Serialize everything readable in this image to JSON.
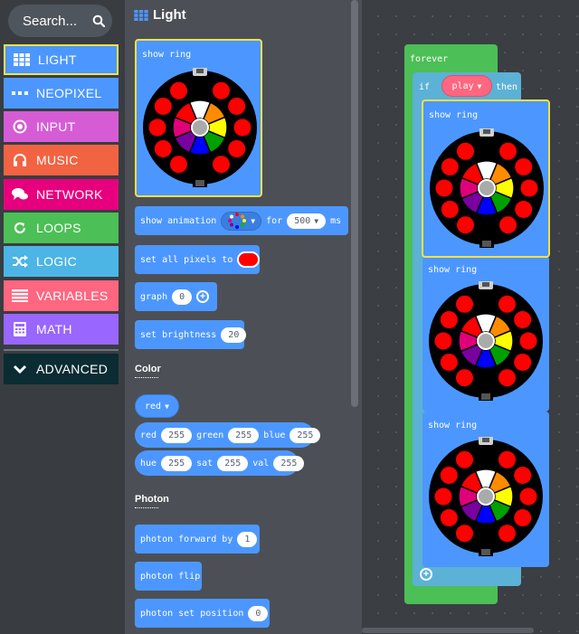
{
  "sidebar": {
    "search": {
      "label": "Search...",
      "icon": "search-icon"
    },
    "categories": [
      {
        "label": "LIGHT",
        "color": "#4c97ff",
        "icon": "grid-icon",
        "selected": true
      },
      {
        "label": "NEOPIXEL",
        "color": "#4c97ff",
        "icon": "dots-icon"
      },
      {
        "label": "INPUT",
        "color": "#d65cd6",
        "icon": "radio-circle-icon"
      },
      {
        "label": "MUSIC",
        "color": "#f26342",
        "icon": "headphones-icon"
      },
      {
        "label": "NETWORK",
        "color": "#e6007e",
        "icon": "chat-icon"
      },
      {
        "label": "LOOPS",
        "color": "#4cbf56",
        "icon": "refresh-icon"
      },
      {
        "label": "LOGIC",
        "color": "#4cb5e5",
        "icon": "shuffle-icon"
      },
      {
        "label": "VARIABLES",
        "color": "#ff6680",
        "icon": "list-lines-icon"
      },
      {
        "label": "MATH",
        "color": "#9966ff",
        "icon": "calculator-icon"
      },
      {
        "label": "ADVANCED",
        "color": "#0b2c33",
        "icon": "chevron-down-icon"
      }
    ]
  },
  "flyout": {
    "title": "Light",
    "blocks": {
      "show_ring": "show ring",
      "show_animation": "show animation",
      "show_animation_for": "for",
      "show_animation_duration": "500",
      "show_animation_unit": "ms",
      "set_all_pixels_to": "set all pixels to",
      "graph": "graph",
      "graph_value": "0",
      "set_brightness": "set brightness",
      "set_brightness_value": "20"
    },
    "color_section": {
      "label": "Color",
      "red_dropdown": "red",
      "rgb": {
        "red_label": "red",
        "red": "255",
        "green_label": "green",
        "green": "255",
        "blue_label": "blue",
        "blue": "255"
      },
      "hsv": {
        "hue_label": "hue",
        "hue": "255",
        "sat_label": "sat",
        "sat": "255",
        "val_label": "val",
        "val": "255"
      }
    },
    "photon_section": {
      "label": "Photon",
      "forward_label": "photon forward by",
      "forward_value": "1",
      "flip_label": "photon flip",
      "set_position_label": "photon set position",
      "set_position_value": "0"
    }
  },
  "workspace": {
    "forever": "forever",
    "if": "if",
    "condition": "play",
    "then": "then",
    "ring_labels": [
      "show ring",
      "show ring",
      "show ring"
    ]
  },
  "colors": {
    "light_block": "#4c97ff",
    "loops_block": "#4cbf56",
    "logic_block": "#5cb1d6",
    "variable_pill": "#ff6680",
    "selection_outline": "#f6e04b",
    "ring_segments": [
      "#ffffff",
      "#ff8c00",
      "#ffff00",
      "#00a000",
      "#0000ff",
      "#7a00a0",
      "#e0007a",
      "#ff0000"
    ]
  }
}
